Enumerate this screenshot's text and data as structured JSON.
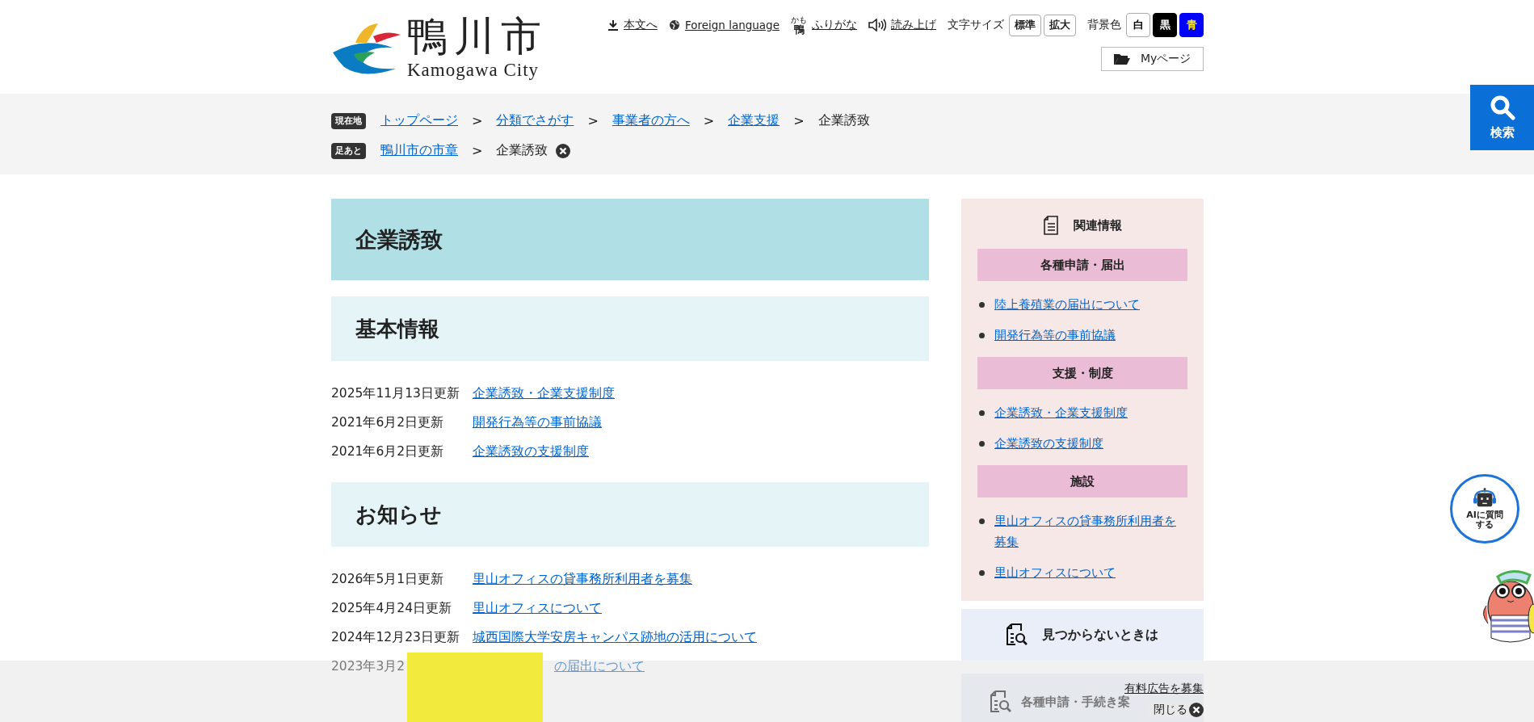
{
  "header": {
    "logo": {
      "name": "鴨川市",
      "subtitle": "Kamogawa City"
    },
    "tools": [
      {
        "kind": "download",
        "label": "本文へ"
      },
      {
        "kind": "globe",
        "label": "Foreign language"
      },
      {
        "kind": "ruby",
        "ruby": "かも",
        "base": "鴨",
        "label": "ふりがな"
      },
      {
        "kind": "speaker",
        "label": "読み上げ"
      }
    ],
    "font_size": {
      "label": "文字サイズ",
      "buttons": [
        "標準",
        "拡大"
      ]
    },
    "background": {
      "label": "背景色",
      "buttons": [
        {
          "label": "白",
          "kind": "white"
        },
        {
          "label": "黒",
          "kind": "black"
        },
        {
          "label": "青",
          "kind": "blue"
        }
      ]
    },
    "mypage": "Myページ"
  },
  "breadcrumb": {
    "badge": "現在地",
    "items": [
      {
        "kind": "link",
        "text": "トップページ"
      },
      {
        "kind": "sep",
        "text": ">"
      },
      {
        "kind": "link",
        "text": "分類でさがす"
      },
      {
        "kind": "sep",
        "text": ">"
      },
      {
        "kind": "link",
        "text": "事業者の方へ"
      },
      {
        "kind": "sep",
        "text": ">"
      },
      {
        "kind": "link",
        "text": "企業支援"
      },
      {
        "kind": "sep",
        "text": ">"
      },
      {
        "kind": "current",
        "text": "企業誘致"
      }
    ]
  },
  "footprint": {
    "badge": "足あと",
    "items": [
      {
        "kind": "link",
        "text": "鴨川市の市章"
      },
      {
        "kind": "sep",
        "text": ">"
      },
      {
        "kind": "current",
        "text": "企業誘致"
      }
    ]
  },
  "search_button": "検索",
  "page_title": "企業誘致",
  "sections": [
    {
      "heading": "基本情報",
      "rows": [
        {
          "date": "2025年11月13日更新",
          "link": "企業誘致・企業支援制度",
          "kind": "full"
        },
        {
          "date": "2021年6月2日更新",
          "link": "開発行為等の事前協議",
          "kind": "full"
        },
        {
          "date": "2021年6月2日更新",
          "link": "企業誘致の支援制度",
          "kind": "full"
        }
      ]
    },
    {
      "heading": "お知らせ",
      "rows": [
        {
          "date": "2026年5月1日更新",
          "link": "里山オフィスの貸事務所利用者を募集",
          "kind": "full"
        },
        {
          "date": "2025年4月24日更新",
          "link": "里山オフィスについて",
          "kind": "full"
        },
        {
          "date": "2024年12月23日更新",
          "link": "城西国際大学安房キャンパス跡地の活用について",
          "kind": "full"
        },
        {
          "date": "2023年3月2",
          "link": "の届出について",
          "kind": "covered"
        }
      ]
    }
  ],
  "sidebar": {
    "title": "関連情報",
    "groups": [
      {
        "heading": "各種申請・届出",
        "links": [
          "陸上養殖業の届出について",
          "開発行為等の事前協議"
        ]
      },
      {
        "heading": "支援・制度",
        "links": [
          "企業誘致・企業支援制度",
          "企業誘致の支援制度"
        ]
      },
      {
        "heading": "施設",
        "links": [
          "里山オフィスの貸事務所利用者を募集",
          "里山オフィスについて"
        ]
      }
    ],
    "not_found": "見つからないときは",
    "procedures": "各種申請・手続き案"
  },
  "ai_button": [
    "AIに質問",
    "する"
  ],
  "ad_bar": {
    "recruit": "有料広告を募集",
    "close": "閉じる"
  }
}
